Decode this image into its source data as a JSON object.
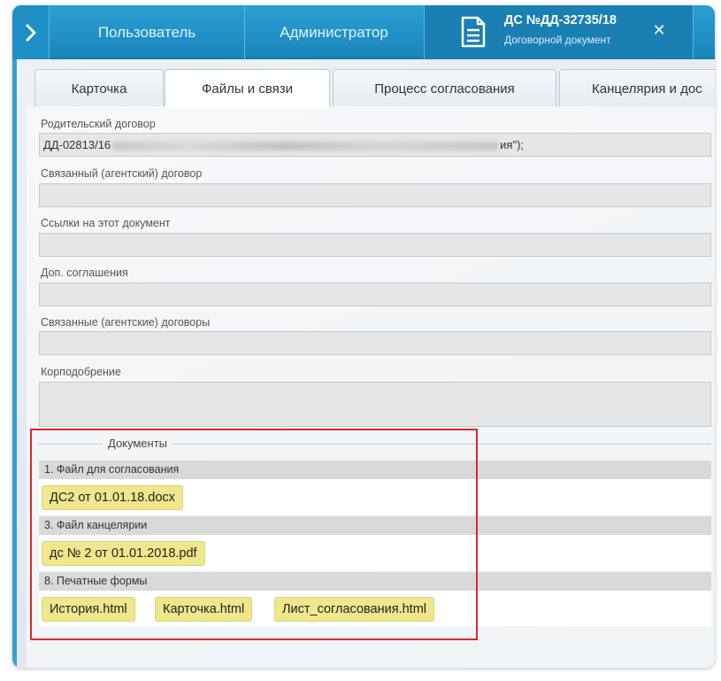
{
  "header": {
    "tabs": [
      "Пользователь",
      "Администратор"
    ],
    "document_tab": {
      "title": "ДС №ДД-32735/18",
      "subtitle": "Договорной документ",
      "close": "✕"
    }
  },
  "subtabs": [
    "Карточка",
    "Файлы и связи",
    "Процесс согласования",
    "Канцелярия и дос"
  ],
  "fields": {
    "parent_contract": {
      "label": "Родительский договор",
      "value_prefix": "ДД-02813/16",
      "value_suffix": "ия\");"
    },
    "linked_agent_contract": {
      "label": "Связанный (агентский) договор",
      "value": ""
    },
    "links_to_document": {
      "label": "Ссылки на этот документ",
      "value": ""
    },
    "additional_agreements": {
      "label": "Доп. соглашения",
      "value": ""
    },
    "linked_agent_contracts": {
      "label": "Связанные (агентские) договоры",
      "value": ""
    },
    "corp_approval": {
      "label": "Корподобрение",
      "value": ""
    }
  },
  "documents": {
    "title": "Документы",
    "sections": [
      {
        "title": "1. Файл для согласования",
        "files": [
          "ДС2 от 01.01.18.docx"
        ]
      },
      {
        "title": "3. Файл канцелярии",
        "files": [
          "дс № 2 от 01.01.2018.pdf"
        ]
      },
      {
        "title": "8. Печатные формы",
        "files": [
          "История.html",
          "Карточка.html",
          "Лист_согласования.html"
        ]
      }
    ]
  },
  "colors": {
    "header_blue": "#1b86bd",
    "chip_yellow": "#f0e68c",
    "highlight_red": "#e0262b"
  }
}
